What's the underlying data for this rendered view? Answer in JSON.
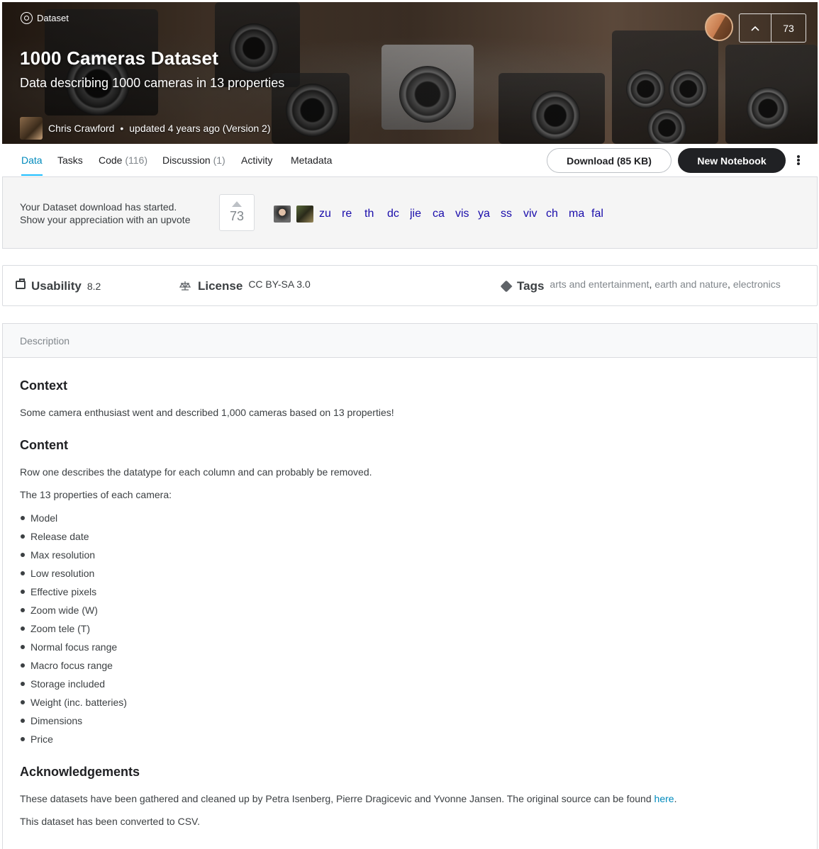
{
  "hero": {
    "type_label": "Dataset",
    "title": "1000 Cameras Dataset",
    "subtitle": "Data describing 1000 cameras in 13 properties",
    "owner": "Chris Crawford",
    "updated": "updated 4 years ago (Version 2)",
    "upvotes": "73"
  },
  "tabs": [
    {
      "label": "Data",
      "count": ""
    },
    {
      "label": "Tasks",
      "count": ""
    },
    {
      "label": "Code",
      "count": "(116)"
    },
    {
      "label": "Discussion",
      "count": "(1)"
    },
    {
      "label": "Activity",
      "count": ""
    },
    {
      "label": "Metadata",
      "count": ""
    }
  ],
  "actions": {
    "download": "Download (85 KB)",
    "new_notebook": "New Notebook"
  },
  "download_panel": {
    "line1": "Your Dataset download has started.",
    "line2": "Show your appreciation with an upvote",
    "upvotes": "73",
    "voter_links": [
      "zu",
      "re",
      "th",
      "dc",
      "jie",
      "ca",
      "vis",
      "ya",
      "ss",
      "viv",
      "ch",
      "ma",
      "fal"
    ]
  },
  "meta": {
    "usability_label": "Usability",
    "usability_value": "8.2",
    "license_label": "License",
    "license_value": "CC BY-SA 3.0",
    "tags_label": "Tags",
    "tags": [
      "arts and entertainment",
      "earth and nature",
      "electronics"
    ]
  },
  "description": {
    "header": "Description",
    "context_heading": "Context",
    "context_text": "Some camera enthusiast went and described 1,000 cameras based on 13 properties!",
    "content_heading": "Content",
    "content_text1": "Row one describes the datatype for each column and can probably be removed.",
    "content_text2": "The 13 properties of each camera:",
    "properties": [
      "Model",
      "Release date",
      "Max resolution",
      "Low resolution",
      "Effective pixels",
      "Zoom wide (W)",
      "Zoom tele (T)",
      "Normal focus range",
      "Macro focus range",
      "Storage included",
      "Weight (inc. batteries)",
      "Dimensions",
      "Price"
    ],
    "ack_heading": "Acknowledgements",
    "ack_text": "These datasets have been gathered and cleaned up by Petra Isenberg, Pierre Dragicevic and Yvonne Jansen. The original source can be found ",
    "ack_link": "here",
    "ack_end": ".",
    "converted_text": "This dataset has been converted to CSV."
  },
  "colors": {
    "accent": "#008abc",
    "dark_button": "#202124",
    "link": "#1a0dab"
  }
}
